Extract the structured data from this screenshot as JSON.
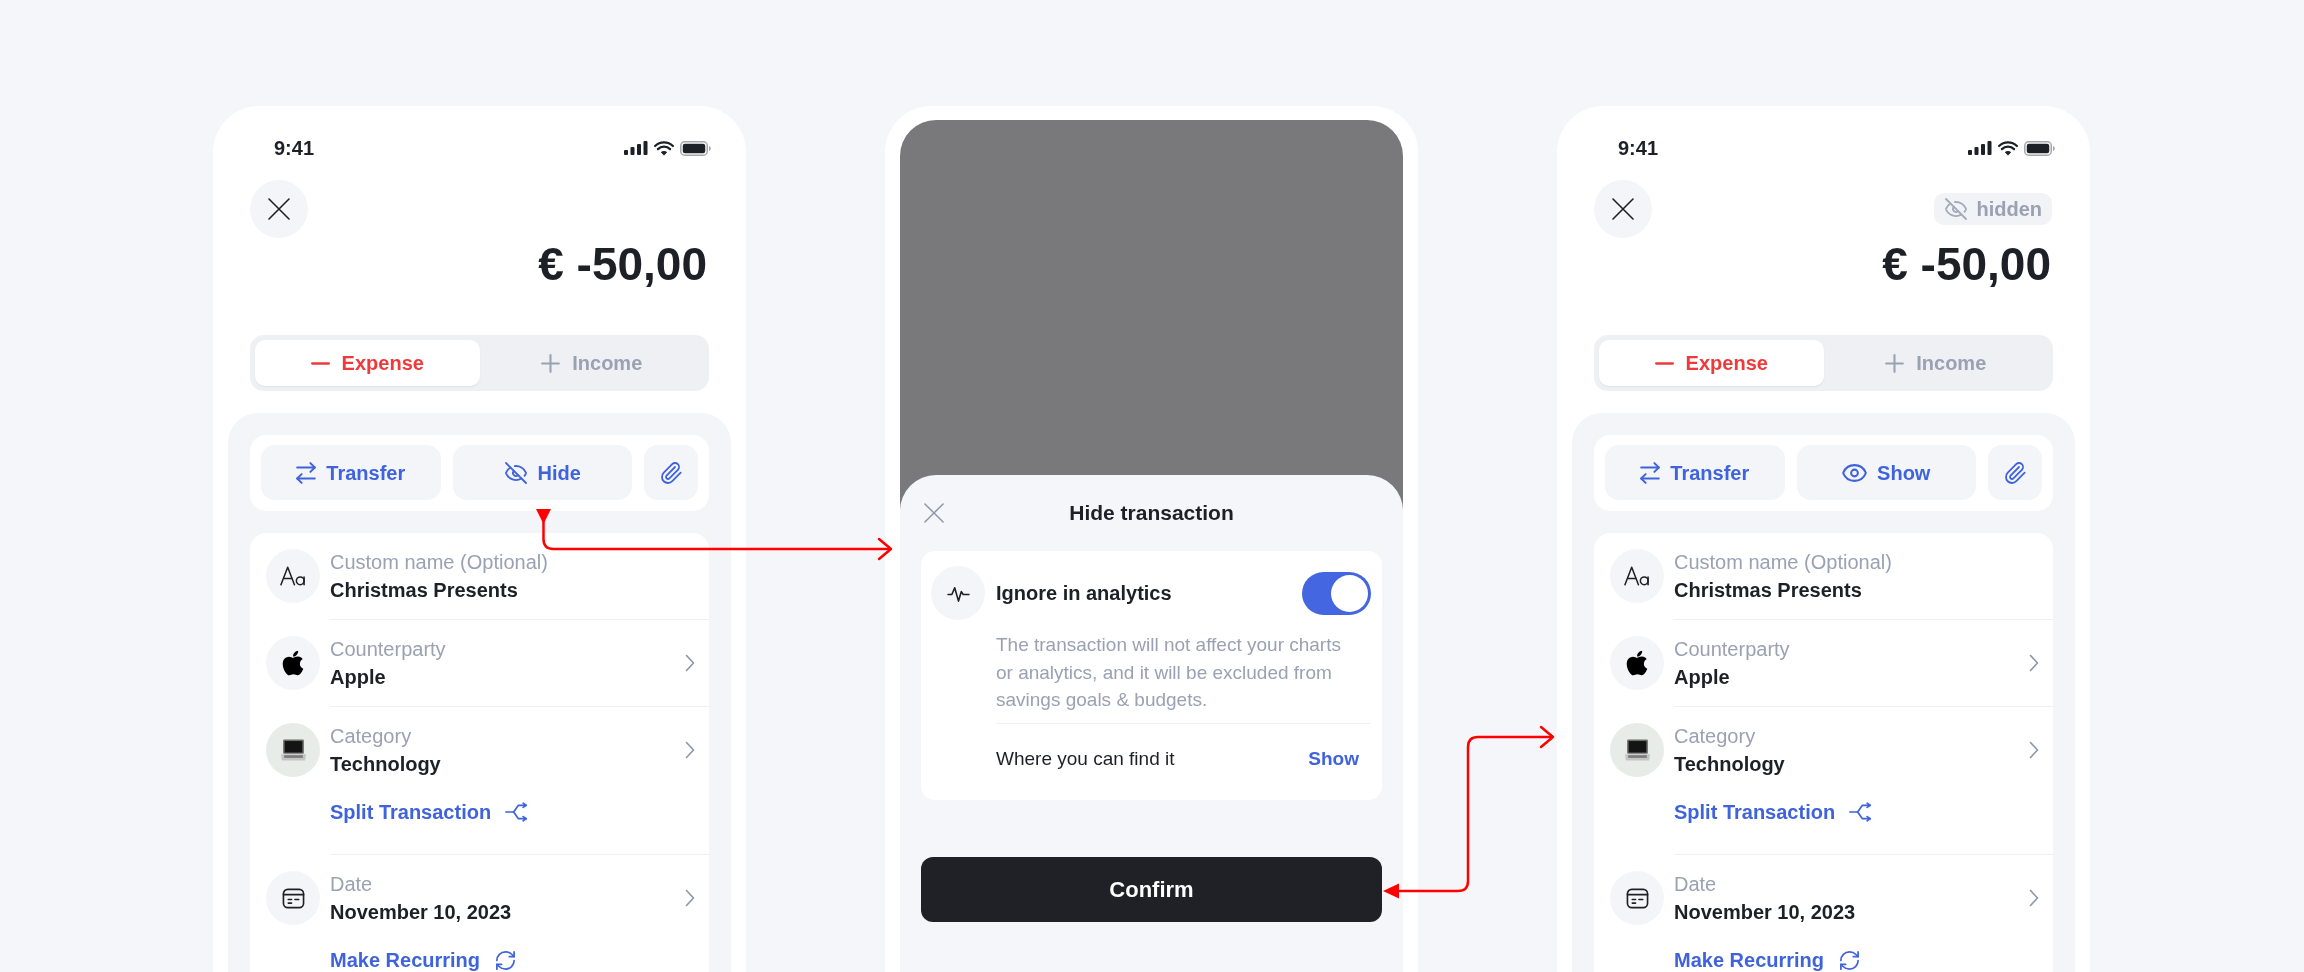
{
  "screens": [
    {
      "kind": "detail",
      "status_bar": {
        "time": "9:41"
      },
      "amount": "€ -50,00",
      "type_tabs": [
        {
          "kind": "expense",
          "label": "Expense",
          "selected": true
        },
        {
          "kind": "income",
          "label": "Income",
          "selected": false
        }
      ],
      "actions": [
        {
          "kind": "transfer",
          "label": "Transfer"
        },
        {
          "kind": "hide",
          "label": "Hide"
        },
        {
          "kind": "attach"
        }
      ],
      "fields": [
        {
          "kind": "name",
          "label": "Custom name (Optional)",
          "value": "Christmas Presents"
        },
        {
          "kind": "counterparty",
          "label": "Counterparty",
          "value": "Apple"
        },
        {
          "kind": "category",
          "label": "Category",
          "value": "Technology",
          "link": {
            "kind": "split",
            "label": "Split Transaction"
          }
        },
        {
          "kind": "date",
          "label": "Date",
          "value": "November 10, 2023",
          "link": {
            "kind": "recurring",
            "label": "Make Recurring"
          }
        }
      ]
    },
    {
      "kind": "sheet",
      "sheet": {
        "title": "Hide transaction",
        "option": {
          "label": "Ignore in analytics",
          "on": true,
          "description": "The transaction will not affect your charts or analytics, and it will be excluded from savings goals & budgets.",
          "footer_label": "Where you can find it",
          "footer_link": "Show"
        },
        "confirm": "Confirm"
      }
    },
    {
      "kind": "detail",
      "status_bar": {
        "time": "9:41"
      },
      "badge": {
        "label": "hidden"
      },
      "amount": "€ -50,00",
      "type_tabs": [
        {
          "kind": "expense",
          "label": "Expense",
          "selected": true
        },
        {
          "kind": "income",
          "label": "Income",
          "selected": false
        }
      ],
      "actions": [
        {
          "kind": "transfer",
          "label": "Transfer"
        },
        {
          "kind": "show",
          "label": "Show"
        },
        {
          "kind": "attach"
        }
      ],
      "fields": [
        {
          "kind": "name",
          "label": "Custom name (Optional)",
          "value": "Christmas Presents"
        },
        {
          "kind": "counterparty",
          "label": "Counterparty",
          "value": "Apple"
        },
        {
          "kind": "category",
          "label": "Category",
          "value": "Technology",
          "link": {
            "kind": "split",
            "label": "Split Transaction"
          }
        },
        {
          "kind": "date",
          "label": "Date",
          "value": "November 10, 2023",
          "link": {
            "kind": "recurring",
            "label": "Make Recurring"
          }
        }
      ]
    }
  ]
}
